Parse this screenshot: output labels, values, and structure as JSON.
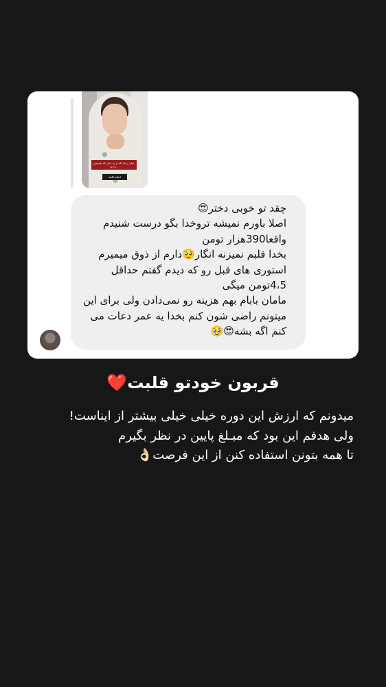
{
  "message_card": {
    "reply_thumbnail": {
      "caption": "خیلی زمانه که از یه دختر که ظرفش داری...",
      "sticker": "انجام کلمه"
    },
    "bubble_text": "چقد تو خوبی دختر😍\nاصلا باورم نمیشه تروخدا بگو درست شنیدم\nواقعا390هزار تومن\nبخدا قلبم نمیزنه انگار🥹دارم از ذوق میمیرم\nاستوری های قبل رو که دیدم گفتم حداقل\n4،5تومن میگی\nمامان بابام بهم هزینه رو نمی‌دادن ولی برای این\nمیتونم راضی شون کنم بخدا یه عمر دعات می\nکنم اگه بشه😍🥹"
  },
  "headline": "قربون خودتو قلبت❤️",
  "body_text": "میدونم که ارزش این دوره خیلی خیلی بیشتر از ایناست!\nولی هدفم این بود که مبـلغ پایین در نظر بگیرم\nتا همه بتونن استفاده کنن از این فرصت👌🏻"
}
